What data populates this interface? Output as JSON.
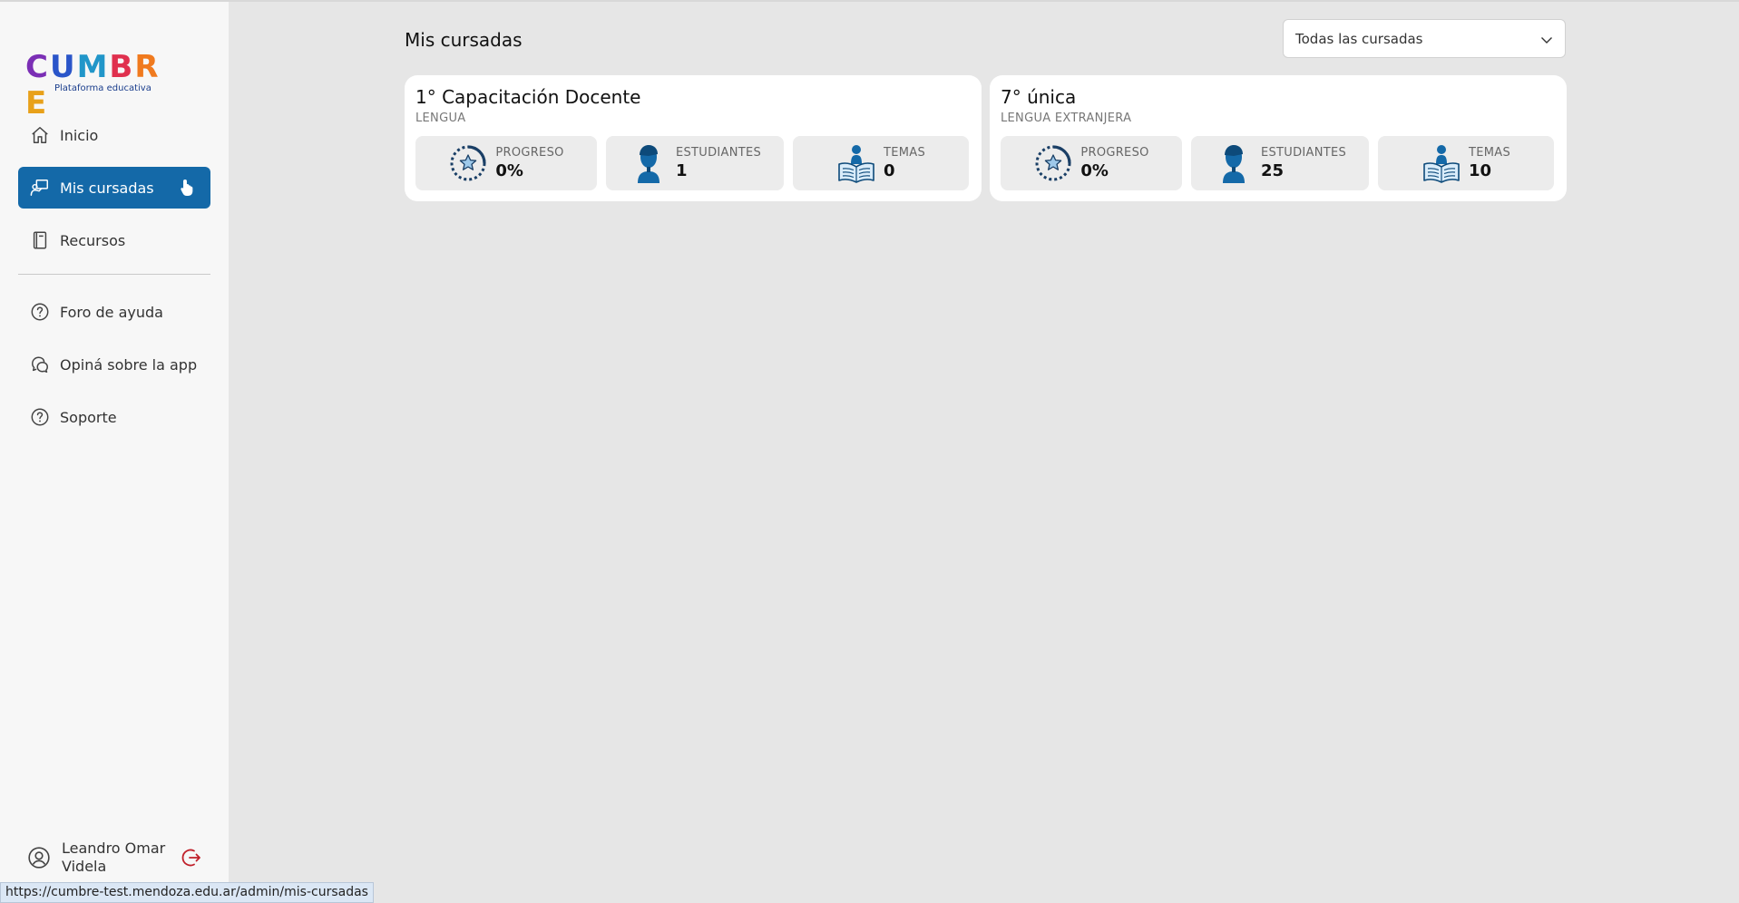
{
  "app": {
    "logo_text": "CUMBRE",
    "logo_subtitle": "Plataforma educativa"
  },
  "colors": {
    "accent": "#1469a8",
    "page_bg": "#e6e6e6",
    "sidebar_bg": "#f7f7f7",
    "logout": "#c0202a"
  },
  "sidebar": {
    "items": [
      {
        "label": "Inicio",
        "icon": "home-icon",
        "active": false
      },
      {
        "label": "Mis cursadas",
        "icon": "teacher-board-icon",
        "active": true
      },
      {
        "label": "Recursos",
        "icon": "book-icon",
        "active": false
      },
      {
        "label": "Foro de ayuda",
        "icon": "help-circle-icon",
        "active": false
      },
      {
        "label": "Opiná sobre la app",
        "icon": "chat-bubbles-icon",
        "active": false
      },
      {
        "label": "Soporte",
        "icon": "help-circle-icon",
        "active": false
      }
    ],
    "user": {
      "name": "Leandro Omar Videla",
      "icon": "user-circle-icon",
      "logout_icon": "logout-icon"
    }
  },
  "main": {
    "title": "Mis cursadas",
    "filter": {
      "selected": "Todas las cursadas"
    },
    "courses": [
      {
        "title": "1° Capacitación Docente",
        "subject": "LENGUA",
        "stats": [
          {
            "label": "PROGRESO",
            "value": "0%",
            "icon": "progress-star-icon"
          },
          {
            "label": "ESTUDIANTES",
            "value": "1",
            "icon": "student-icon"
          },
          {
            "label": "TEMAS",
            "value": "0",
            "icon": "reading-book-icon"
          }
        ]
      },
      {
        "title": "7° única",
        "subject": "LENGUA EXTRANJERA",
        "stats": [
          {
            "label": "PROGRESO",
            "value": "0%",
            "icon": "progress-star-icon"
          },
          {
            "label": "ESTUDIANTES",
            "value": "25",
            "icon": "student-icon"
          },
          {
            "label": "TEMAS",
            "value": "10",
            "icon": "reading-book-icon"
          }
        ]
      }
    ]
  },
  "status_bar": {
    "url": "https://cumbre-test.mendoza.edu.ar/admin/mis-cursadas"
  }
}
